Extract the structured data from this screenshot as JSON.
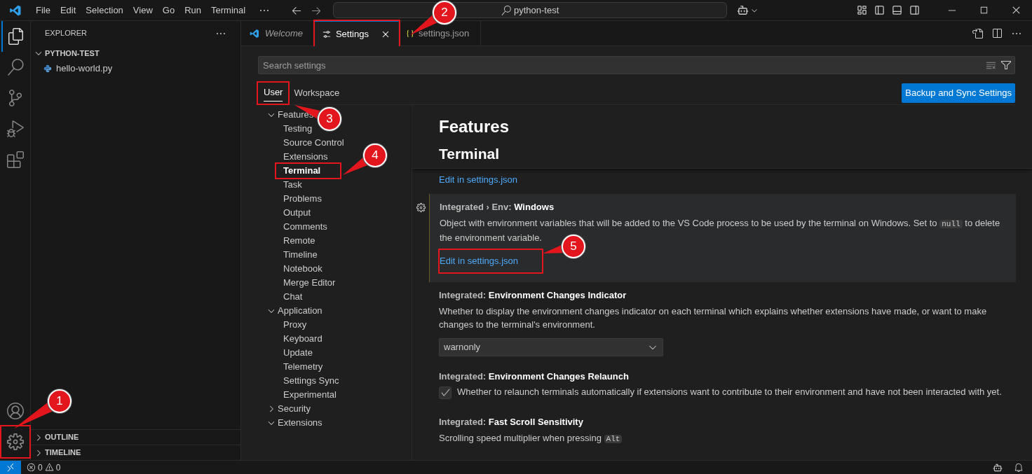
{
  "title_bar": {
    "menus": [
      "File",
      "Edit",
      "Selection",
      "View",
      "Go",
      "Run",
      "Terminal"
    ],
    "command_center": "python-test"
  },
  "activity_bar": {
    "items": [
      {
        "kind": "files",
        "selected": true
      },
      {
        "kind": "search",
        "selected": false
      },
      {
        "kind": "source-control",
        "selected": false
      },
      {
        "kind": "run-debug",
        "selected": false
      },
      {
        "kind": "extensions",
        "selected": false
      }
    ],
    "bottom": [
      {
        "kind": "account",
        "highlighted": false
      },
      {
        "kind": "manage",
        "highlighted": true
      }
    ]
  },
  "sidebar": {
    "title": "EXPLORER",
    "folder": {
      "name": "PYTHON-TEST",
      "expanded": true,
      "files": [
        "hello-world.py"
      ]
    },
    "panels": [
      {
        "name": "OUTLINE",
        "expanded": false
      },
      {
        "name": "TIMELINE",
        "expanded": false
      }
    ]
  },
  "editor_tabs": [
    {
      "kind": "welcome",
      "label": "Welcome",
      "selected": false,
      "preview": true,
      "highlighted": false
    },
    {
      "kind": "settings",
      "label": "Settings",
      "selected": true,
      "preview": false,
      "highlighted": true
    },
    {
      "kind": "json",
      "label": "settings.json",
      "selected": false,
      "preview": false,
      "highlighted": false
    }
  ],
  "settings": {
    "search": {
      "placeholder": "Search settings"
    },
    "scope_tabs": [
      {
        "label": "User",
        "selected": true,
        "highlighted": true
      },
      {
        "label": "Workspace",
        "selected": false,
        "highlighted": false
      }
    ],
    "sync_button": "Backup and Sync Settings",
    "toc": [
      {
        "label": "Features",
        "expanded": true,
        "selected": false,
        "highlighted": false,
        "children": [
          {
            "label": "Testing",
            "selected": false,
            "highlighted": false
          },
          {
            "label": "Source Control",
            "selected": false,
            "highlighted": false
          },
          {
            "label": "Extensions",
            "selected": false,
            "highlighted": false
          },
          {
            "label": "Terminal",
            "selected": true,
            "highlighted": true
          },
          {
            "label": "Task",
            "selected": false,
            "highlighted": false
          },
          {
            "label": "Problems",
            "selected": false,
            "highlighted": false
          },
          {
            "label": "Output",
            "selected": false,
            "highlighted": false
          },
          {
            "label": "Comments",
            "selected": false,
            "highlighted": false
          },
          {
            "label": "Remote",
            "selected": false,
            "highlighted": false
          },
          {
            "label": "Timeline",
            "selected": false,
            "highlighted": false
          },
          {
            "label": "Notebook",
            "selected": false,
            "highlighted": false
          },
          {
            "label": "Merge Editor",
            "selected": false,
            "highlighted": false
          },
          {
            "label": "Chat",
            "selected": false,
            "highlighted": false
          }
        ]
      },
      {
        "label": "Application",
        "expanded": true,
        "selected": false,
        "highlighted": false,
        "children": [
          {
            "label": "Proxy",
            "selected": false,
            "highlighted": false
          },
          {
            "label": "Keyboard",
            "selected": false,
            "highlighted": false
          },
          {
            "label": "Update",
            "selected": false,
            "highlighted": false
          },
          {
            "label": "Telemetry",
            "selected": false,
            "highlighted": false
          },
          {
            "label": "Settings Sync",
            "selected": false,
            "highlighted": false
          },
          {
            "label": "Experimental",
            "selected": false,
            "highlighted": false
          }
        ]
      },
      {
        "label": "Security",
        "expanded": false,
        "selected": false,
        "highlighted": false
      },
      {
        "label": "Extensions",
        "expanded": true,
        "selected": false,
        "highlighted": false
      }
    ],
    "headers": [
      "Features",
      "Terminal"
    ],
    "items": [
      {
        "kind": "link",
        "link": "Edit in settings.json",
        "highlighted": false
      },
      {
        "kind": "object",
        "focused": true,
        "category": "Integrated › Env:",
        "name": "Windows",
        "description": "Object with environment variables that will be added to the VS Code process to be used by the terminal on Windows. Set to",
        "code": "null",
        "description_end": "to delete the environment variable.",
        "link": "Edit in settings.json",
        "highlighted": true
      },
      {
        "kind": "dropdown",
        "focused": false,
        "category": "Integrated:",
        "name": "Environment Changes Indicator",
        "description": "Whether to display the environment changes indicator on each terminal which explains whether extensions have made, or want to make changes to the terminal's environment.",
        "value": "warnonly"
      },
      {
        "kind": "checkbox",
        "focused": false,
        "category": "Integrated:",
        "name": "Environment Changes Relaunch",
        "description": "Whether to relaunch terminals automatically if extensions want to contribute to their environment and have not been interacted with yet.",
        "checked": true
      },
      {
        "kind": "number",
        "focused": false,
        "category": "Integrated:",
        "name": "Fast Scroll Sensitivity",
        "description": "Scrolling speed multiplier when pressing",
        "code": "Alt"
      }
    ]
  },
  "status_bar": {
    "errors": "0",
    "warnings": "0"
  },
  "callouts": [
    "1",
    "2",
    "3",
    "4",
    "5"
  ]
}
